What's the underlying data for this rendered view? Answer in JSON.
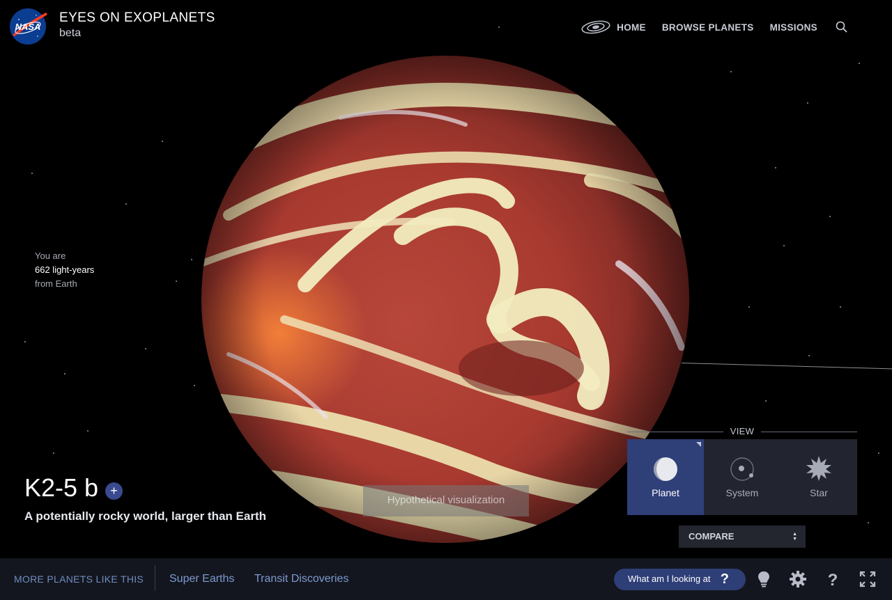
{
  "header": {
    "title": "EYES ON EXOPLANETS",
    "subtitle": "beta",
    "logo_text": "NASA",
    "nav": {
      "home": "HOME",
      "browse": "BROWSE PLANETS",
      "missions": "MISSIONS"
    },
    "icons": [
      "galaxy-icon",
      "search-icon"
    ]
  },
  "distance": {
    "line1": "You are",
    "line2": "662 light-years",
    "line3": "from Earth"
  },
  "planet": {
    "name": "K2-5 b",
    "add_label": "+",
    "description": "A potentially rocky world, larger than Earth",
    "visualization_note": "Hypothetical visualization"
  },
  "view": {
    "label": "VIEW",
    "options": [
      {
        "label": "Planet",
        "icon": "planet-icon",
        "active": true
      },
      {
        "label": "System",
        "icon": "system-icon",
        "active": false
      },
      {
        "label": "Star",
        "icon": "star-icon",
        "active": false
      }
    ]
  },
  "compare": {
    "label": "COMPARE"
  },
  "bottom": {
    "more_label": "MORE PLANETS LIKE THIS",
    "categories": [
      "Super Earths",
      "Transit Discoveries"
    ],
    "help_button": "What am I looking at",
    "help_symbol": "?",
    "tools": [
      "lightbulb-icon",
      "settings-gear-icon",
      "help-icon",
      "fullscreen-icon"
    ]
  },
  "colors": {
    "accent": "#2f3f78",
    "link": "#7d9ad0",
    "bar": "#14161f"
  }
}
